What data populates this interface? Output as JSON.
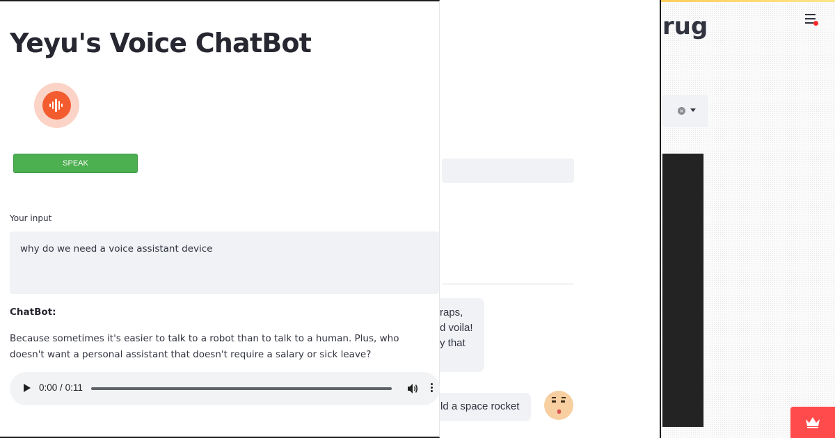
{
  "main": {
    "title": "Yeyu's Voice ChatBot",
    "mic_icon": "voice-waveform-icon",
    "speak_button_label": "SPEAK",
    "input_label": "Your input",
    "input_value": "why do we need a voice assistant device",
    "chatbot_label": "ChatBot:",
    "chatbot_response": "Because sometimes it's easier to talk to a robot than to talk to a human. Plus, who doesn't want a personal assistant that doesn't require a salary or sick leave?",
    "audio": {
      "current_time": "0:00",
      "separator": "/",
      "duration": "0:11",
      "progress": 0
    },
    "colors": {
      "speak_button": "#4caf50",
      "mic_accent": "#f35c2e"
    }
  },
  "middle_panel": {
    "bubble_lines": [
      "raps,",
      "d voila!",
      "y that"
    ],
    "bubble2_text": "ld a space rocket",
    "avatar_icon": "pixel-face-avatar"
  },
  "right_panel": {
    "title_fragment": "rug",
    "menu_icon": "hamburger-menu-icon",
    "accent_color": "#ff4b4b",
    "badge_icon": "crown-icon"
  }
}
